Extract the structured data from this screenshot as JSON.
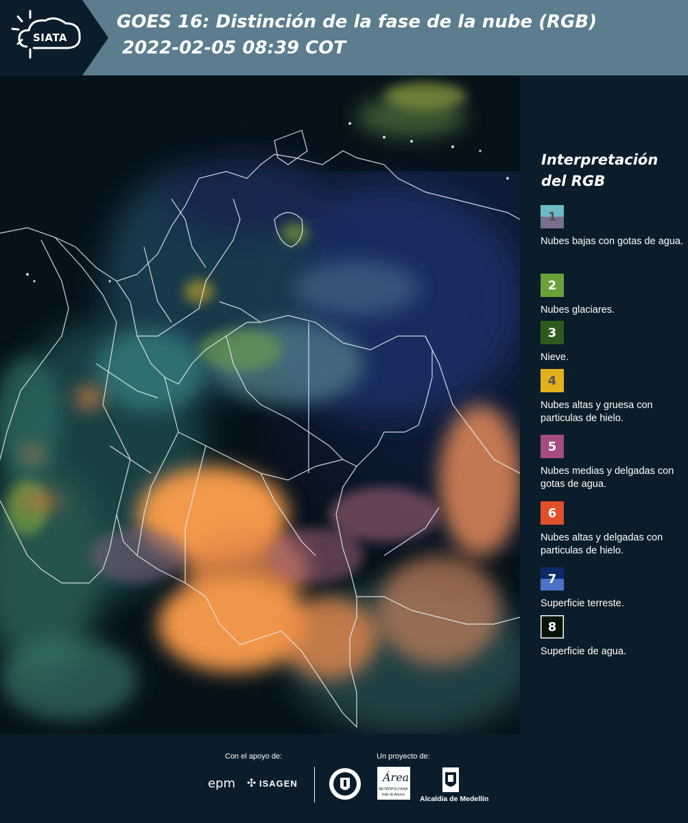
{
  "header": {
    "logo_text": "SIATA",
    "title_line1": "GOES 16: Distinción de la fase de la nube (RGB)",
    "title_line2": "2022-02-05 08:39 COT"
  },
  "legend": {
    "title": "Interpretación del RGB",
    "items": [
      {
        "number": "1",
        "label": "Nubes bajas con gotas de agua.",
        "color_top": "#6bbcc7",
        "color_bottom": "#7a6e8e",
        "text_color": "#555555"
      },
      {
        "number": "2",
        "label": "Nubes glaciares.",
        "color": "#6aa23a",
        "text_color": "#ffffff"
      },
      {
        "number": "3",
        "label": "Nieve.",
        "color": "#2f5a1e",
        "text_color": "#ffffff"
      },
      {
        "number": "4",
        "label": "Nubes altas y gruesa con particulas de hielo.",
        "color": "#e3b11d",
        "text_color": "#555555"
      },
      {
        "number": "5",
        "label": "Nubes medias y delgadas con gotas de agua.",
        "color": "#a64b7f",
        "text_color": "#ffffff"
      },
      {
        "number": "6",
        "label": "Nubes altas y delgadas con particulas de hielo.",
        "color": "#e0502a",
        "text_color": "#ffffff"
      },
      {
        "number": "7",
        "label": "Superficie terreste.",
        "color_top": "#0e2a66",
        "color_bottom": "#4c73c9",
        "text_color": "#ffffff"
      },
      {
        "number": "8",
        "label": "Superficie de agua.",
        "color": "#041408",
        "border": "#ffffff",
        "text_color": "#ffffff"
      }
    ]
  },
  "footer": {
    "support_label": "Con el apoyo de:",
    "project_label": "Un proyecto de:",
    "epm": "epm",
    "isagen": "ISAGEN",
    "area_name": "Área",
    "area_subtitle": "METROPOLITANA",
    "area_subtitle2": "Valle de Aburrá",
    "alcaldia": "Alcaldía de Medellín"
  }
}
